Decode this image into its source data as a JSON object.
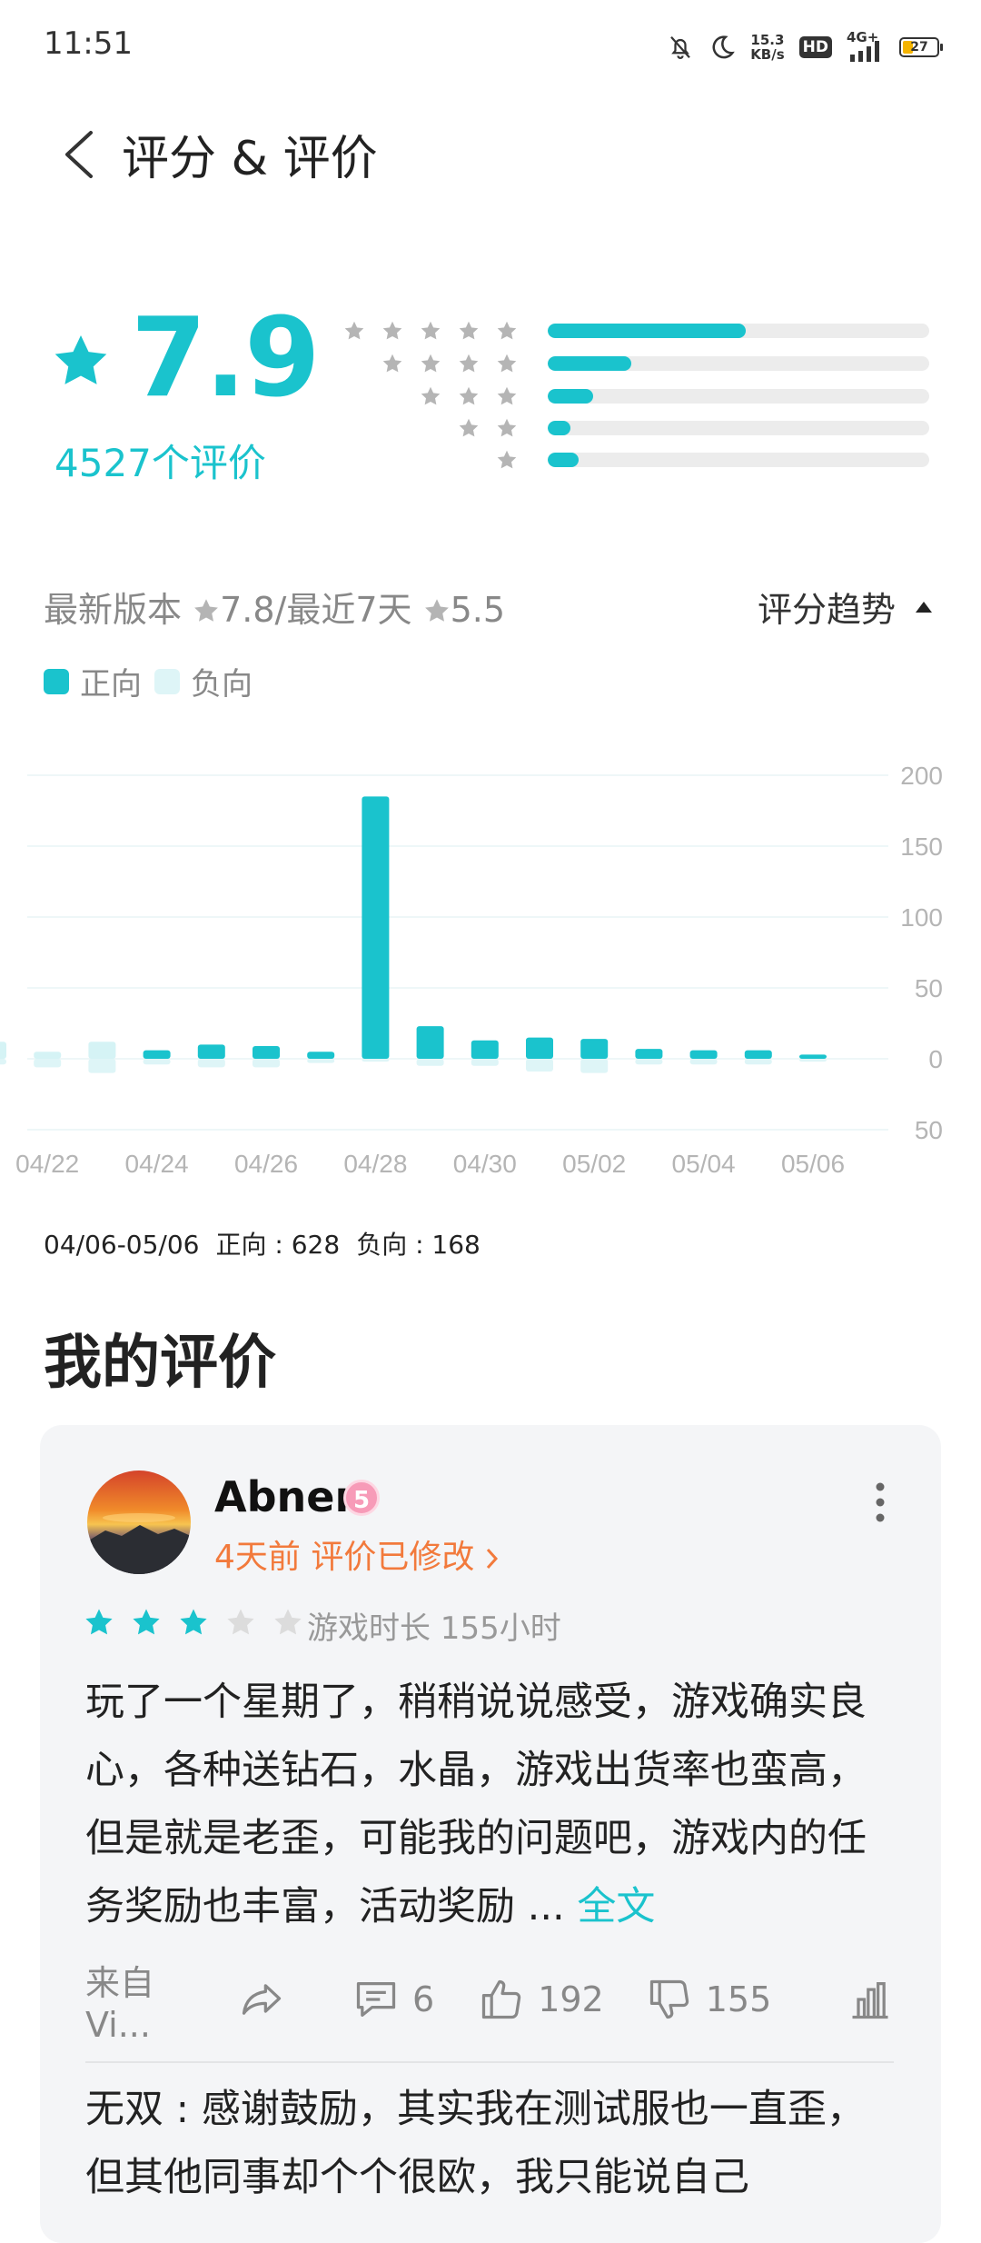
{
  "status_bar": {
    "time": "11:51",
    "net_speed_value": "15.3",
    "net_speed_unit": "KB/s",
    "hd": "HD",
    "network": "4G+",
    "battery": "27",
    "icons": [
      "bell-off-icon",
      "moon-icon",
      "signal-icon",
      "battery-icon"
    ]
  },
  "header": {
    "title": "评分 & 评价",
    "back_icon": "chevron-left-icon"
  },
  "summary": {
    "score": "7.9",
    "count_text": "4527个评价",
    "accent": "#1ac3cd",
    "distribution": [
      {
        "stars": 5,
        "fraction": 0.52
      },
      {
        "stars": 4,
        "fraction": 0.22
      },
      {
        "stars": 3,
        "fraction": 0.12
      },
      {
        "stars": 2,
        "fraction": 0.06
      },
      {
        "stars": 1,
        "fraction": 0.08
      }
    ]
  },
  "version": {
    "latest_label": "最新版本",
    "latest_score": "7.8",
    "separator": "/最近7天",
    "recent_score": "5.5",
    "trend_label": "评分趋势"
  },
  "legend": {
    "positive": "正向",
    "negative": "负向",
    "positive_color": "#1ac3cd",
    "negative_color": "#def5f7"
  },
  "chart_data": {
    "type": "bar",
    "categories": [
      "04/21",
      "04/22",
      "04/23",
      "04/24",
      "04/25",
      "04/26",
      "04/27",
      "04/28",
      "04/29",
      "04/30",
      "05/01",
      "05/02",
      "05/03",
      "05/04",
      "05/05",
      "05/06"
    ],
    "tick_labels": [
      "04/22",
      "04/24",
      "04/26",
      "04/28",
      "04/30",
      "05/02",
      "05/04",
      "05/06"
    ],
    "y_tick_labels": [
      "200",
      "150",
      "100",
      "50",
      "0",
      "50"
    ],
    "ylim": [
      -50,
      200
    ],
    "grid": true,
    "series": [
      {
        "name": "正向",
        "values": [
          12,
          5,
          12,
          6,
          10,
          9,
          5,
          185,
          23,
          13,
          15,
          14,
          7,
          6,
          6,
          3
        ]
      },
      {
        "name": "负向",
        "values": [
          4,
          6,
          10,
          4,
          6,
          6,
          3,
          2,
          5,
          5,
          9,
          10,
          4,
          4,
          4,
          2
        ]
      }
    ]
  },
  "range_info": {
    "range": "04/06-05/06",
    "positive": "正向 : 628",
    "negative": "负向 : 168"
  },
  "my_review": {
    "section_title": "我的评价",
    "user": "Abner",
    "level": "5",
    "meta": "4天前 评价已修改",
    "rating": 3,
    "max_rating": 5,
    "playtime": "游戏时长 155小时",
    "text": "玩了一个星期了，稍稍说说感受，游戏确实良心，各种送钻石，水晶，游戏出货率也蛮高，但是就是老歪，可能我的问题吧，游戏内的任务奖励也丰富，活动奖励 ... ",
    "full_text_link": "全文",
    "source": "来自Vi...",
    "comments": "6",
    "likes": "192",
    "dislikes": "155",
    "reply": "无双 : 感谢鼓励，其实我在测试服也一直歪，但其他同事却个个很欧，我只能说自己"
  }
}
